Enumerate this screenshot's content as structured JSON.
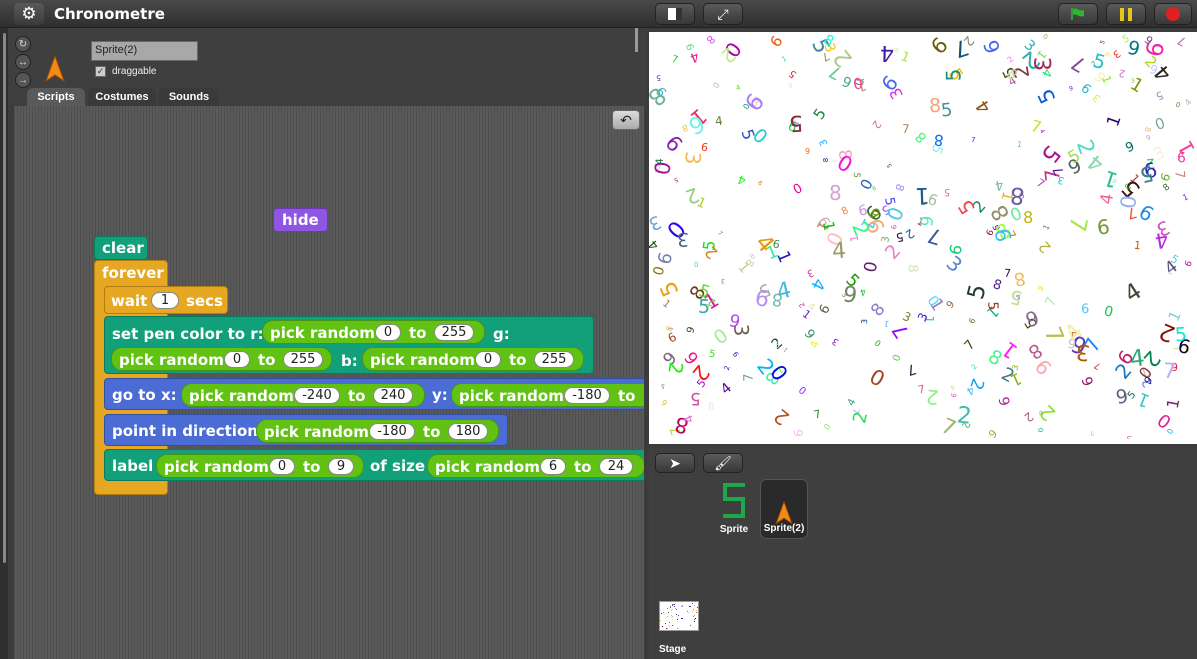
{
  "app": {
    "title": "Chronometre"
  },
  "topbar": {
    "logo_icon": "gear-icon"
  },
  "sprite": {
    "name": "Sprite(2)",
    "draggable_label": "draggable",
    "draggable_checked": "✓"
  },
  "tabs": [
    "Scripts",
    "Costumes",
    "Sounds"
  ],
  "blocks": {
    "hide": "hide",
    "clear": "clear",
    "forever": "forever",
    "wait": {
      "label": "wait",
      "value": "1",
      "unit": "secs"
    },
    "set_pen": {
      "label": "set pen color to r:",
      "r": {
        "label": "pick random",
        "from": "0",
        "to_label": "to",
        "to": "255"
      },
      "g_label": "g:",
      "g": {
        "label": "pick random",
        "from": "0",
        "to_label": "to",
        "to": "255"
      },
      "b_label": "b:",
      "b": {
        "label": "pick random",
        "from": "0",
        "to_label": "to",
        "to": "255"
      }
    },
    "goto": {
      "label": "go to x:",
      "x": {
        "label": "pick random",
        "from": "-240",
        "to_label": "to",
        "to": "240"
      },
      "y_label": "y:",
      "y": {
        "label": "pick random",
        "from": "-180",
        "to_label": "to"
      }
    },
    "point": {
      "label": "point in direction",
      "r": {
        "label": "pick random",
        "from": "-180",
        "to_label": "to",
        "to": "180"
      }
    },
    "label": {
      "label": "label",
      "r": {
        "label": "pick random",
        "from": "0",
        "to_label": "to",
        "to": "9"
      },
      "size_label": "of size",
      "s": {
        "label": "pick random",
        "from": "6",
        "to_label": "to",
        "to": "24"
      }
    }
  },
  "corral": {
    "sprites": [
      {
        "name": "Sprite"
      },
      {
        "name": "Sprite(2)"
      }
    ],
    "stage_label": "Stage"
  }
}
